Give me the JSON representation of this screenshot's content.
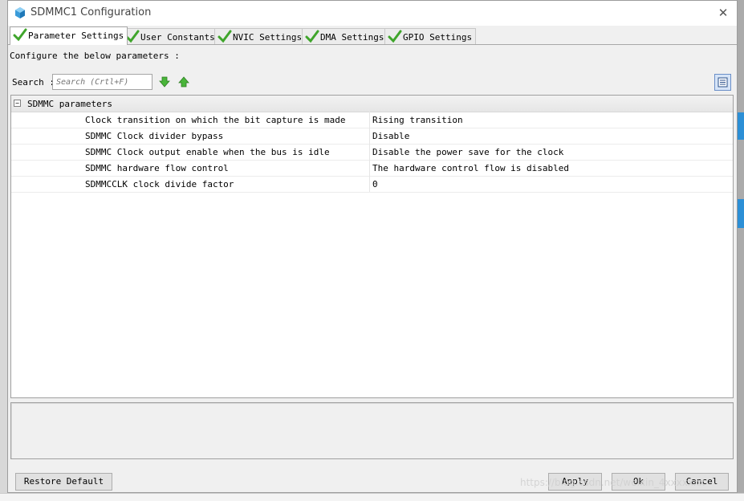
{
  "window": {
    "title": "SDMMC1 Configuration",
    "close_glyph": "✕"
  },
  "tabs": [
    {
      "label": "Parameter Settings",
      "active": true
    },
    {
      "label": "User Constants",
      "active": false
    },
    {
      "label": "NVIC Settings",
      "active": false
    },
    {
      "label": "DMA Settings",
      "active": false
    },
    {
      "label": "GPIO Settings",
      "active": false
    }
  ],
  "panel": {
    "instruction": "Configure the below parameters :",
    "search_label": "Search :",
    "search_placeholder": "Search (Crtl+F)"
  },
  "tree": {
    "group_label": "SDMMC parameters",
    "expander_glyph": "−",
    "params": [
      {
        "name": "Clock transition on which the bit capture is made",
        "value": "Rising transition"
      },
      {
        "name": "SDMMC Clock divider bypass",
        "value": "Disable"
      },
      {
        "name": "SDMMC Clock output enable when the bus is idle",
        "value": "Disable the power save for the clock"
      },
      {
        "name": "SDMMC hardware flow control",
        "value": "The hardware control flow is disabled"
      },
      {
        "name": "SDMMCCLK clock divide factor",
        "value": "0"
      }
    ]
  },
  "buttons": {
    "restore_default": "Restore Default",
    "apply": "Apply",
    "ok": "Ok",
    "cancel": "Cancel"
  },
  "watermark": "https://blog.csdn.net/weixin_4xxxxxxx",
  "icons": {
    "app": "cube-icon",
    "tab_check": "check-icon",
    "search_next": "arrow-down-icon",
    "search_prev": "arrow-up-icon",
    "view_toggle": "list-view-icon"
  },
  "colors": {
    "check_green": "#3fa52b",
    "accent_blue": "#2c8fd6"
  }
}
